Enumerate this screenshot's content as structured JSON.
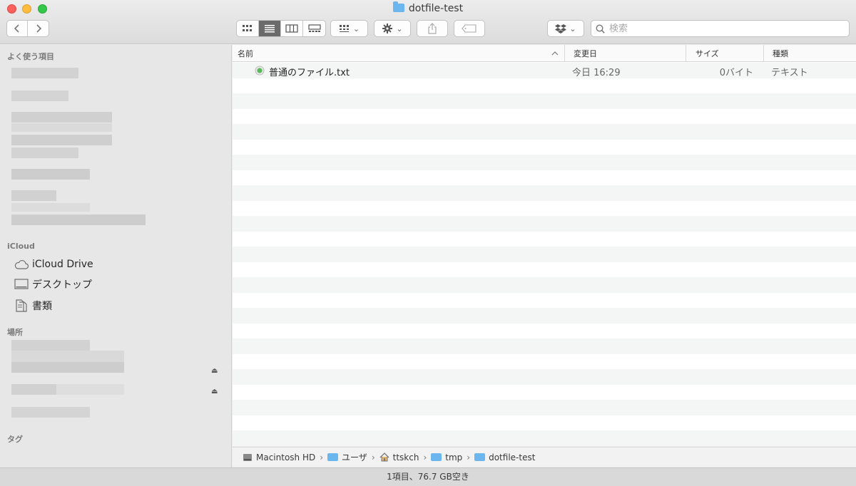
{
  "window": {
    "title": "dotfile-test"
  },
  "toolbar": {
    "search_placeholder": "検索"
  },
  "sidebar": {
    "favorites_header": "よく使う項目",
    "icloud_header": "iCloud",
    "icloud_items": [
      {
        "label": "iCloud Drive",
        "icon": "cloud-icon"
      },
      {
        "label": "デスクトップ",
        "icon": "desktop-icon"
      },
      {
        "label": "書類",
        "icon": "document-icon"
      }
    ],
    "locations_header": "場所",
    "tags_header": "タグ"
  },
  "columns": {
    "name": "名前",
    "modified": "変更日",
    "size": "サイズ",
    "kind": "種類"
  },
  "files": [
    {
      "name": "普通のファイル.txt",
      "modified": "今日 16:29",
      "size": "0バイト",
      "kind": "テキスト"
    }
  ],
  "path": [
    "Macintosh HD",
    "ユーザ",
    "ttskch",
    "tmp",
    "dotfile-test"
  ],
  "status": "1項目、76.7 GB空き"
}
